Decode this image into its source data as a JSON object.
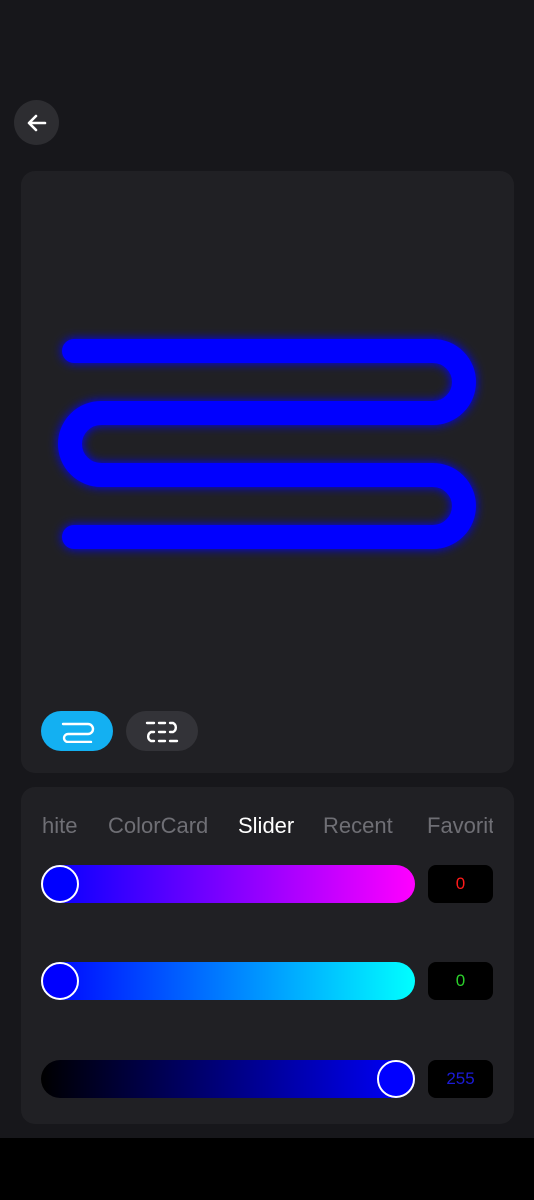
{
  "header": {
    "back_icon": "arrow-left-icon"
  },
  "preview": {
    "neon_color": "#0000ff",
    "modes": [
      {
        "name": "continuous",
        "icon": "continuous-strip-icon",
        "active": true,
        "active_color": "#13b0f2"
      },
      {
        "name": "segmented",
        "icon": "segmented-strip-icon",
        "active": false
      }
    ]
  },
  "tabs": {
    "items": [
      "hite",
      "ColorCard",
      "Slider",
      "Recent",
      "Favorit"
    ],
    "active": "Slider"
  },
  "sliders": [
    {
      "channel": "red",
      "value": "0",
      "value_color": "#ff1a1a",
      "fraction": 0.0,
      "gradient_from": "#0000ff",
      "gradient_to": "#ff00ff"
    },
    {
      "channel": "green",
      "value": "0",
      "value_color": "#2bd12b",
      "fraction": 0.0,
      "gradient_from": "#0000ff",
      "gradient_to": "#00ffff"
    },
    {
      "channel": "blue",
      "value": "255",
      "value_color": "#1b1bd6",
      "fraction": 1.0,
      "gradient_from": "#000000",
      "gradient_to": "#0000ff"
    }
  ]
}
